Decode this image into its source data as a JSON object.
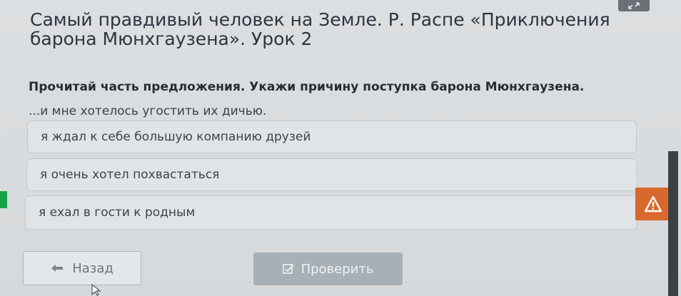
{
  "lesson": {
    "title": "Самый правдивый человек на Земле. Р. Распе «Приключения барона Мюнхгаузена». Урок 2"
  },
  "task": {
    "question": "Прочитай часть предложения. Укажи причину поступка барона Мюнхгаузена.",
    "stem": "...и мне хотелось угостить их дичью.",
    "options": [
      "я ждал к себе большую компанию друзей",
      "я очень хотел похвастаться",
      "я ехал в гости к родным"
    ]
  },
  "navigation": {
    "back_label": "Назад",
    "check_label": "Проверить"
  },
  "icons": {
    "top": "expand-icon",
    "warning": "warning-icon",
    "back": "arrow-left-icon",
    "check": "checkbox-icon"
  },
  "colors": {
    "warning_bg": "#d9682c",
    "check_button_bg": "#a7b0b7",
    "accent_green": "#18a34a"
  }
}
